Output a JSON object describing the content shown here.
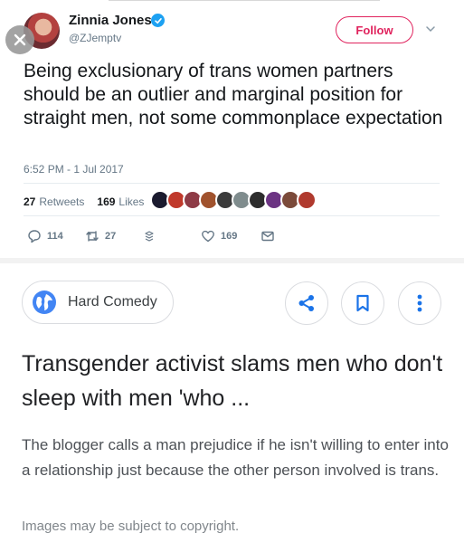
{
  "tweet": {
    "author_name": "Zinnia Jones",
    "author_handle": "@ZJemptv",
    "follow_label": "Follow",
    "text": "Being exclusionary of trans women partners should be an outlier and marginal position for straight men, not some commonplace expectation",
    "timestamp": "6:52 PM - 1 Jul 2017",
    "retweets_count": "27",
    "retweets_label": "Retweets",
    "likes_count": "169",
    "likes_label": "Likes",
    "actions": {
      "reply_count": "114",
      "retweet_count": "27",
      "like_count": "169"
    },
    "colors": {
      "follow": "#e0245e",
      "verified": "#1da1f2",
      "muted": "#657786"
    },
    "liker_avatar_colors": [
      "#1b1b2f",
      "#c0392b",
      "#8e3b46",
      "#a0522d",
      "#3b3b3b",
      "#7f8c8d",
      "#2d2d2d",
      "#6c3483",
      "#7b4a3a",
      "#b03a2e"
    ]
  },
  "result": {
    "source_name": "Hard Comedy",
    "headline": "Transgender activist slams men who don't sleep with men 'who ...",
    "snippet": "The blogger calls a man prejudice if he isn't willing to enter into a relationship just because the other person involved is trans.",
    "copyright": "Images may be subject to copyright.",
    "colors": {
      "accent": "#1a73e8",
      "globe": "#4285f4"
    }
  }
}
